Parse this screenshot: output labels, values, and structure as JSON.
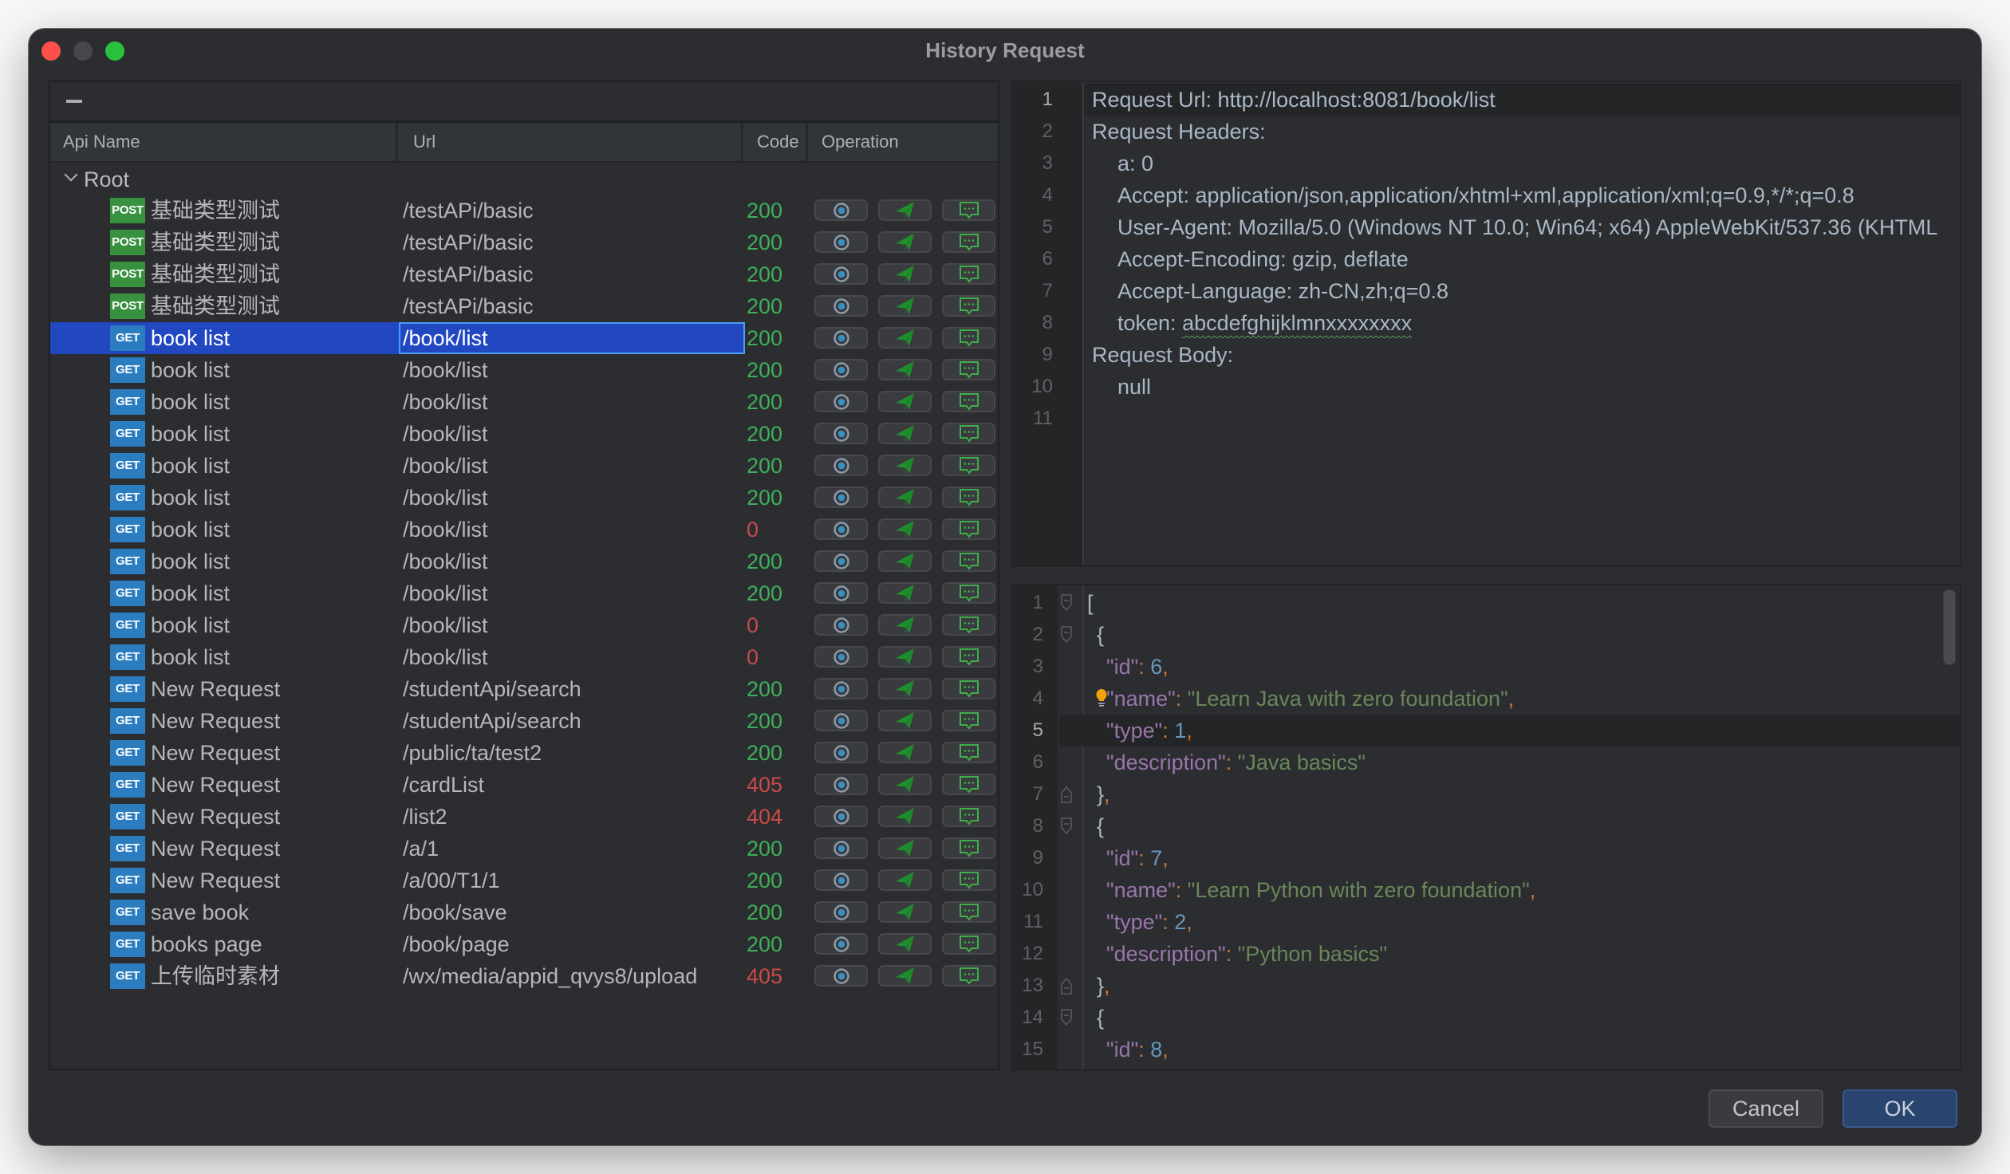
{
  "window": {
    "title": "History Request"
  },
  "table": {
    "columns": {
      "api_name": "Api Name",
      "url": "Url",
      "code": "Code",
      "operation": "Operation"
    },
    "root_label": "Root",
    "selected_index": 4,
    "rows": [
      {
        "method": "POST",
        "name": "基础类型测试",
        "url": "/testAPi/basic",
        "code": "200"
      },
      {
        "method": "POST",
        "name": "基础类型测试",
        "url": "/testAPi/basic",
        "code": "200"
      },
      {
        "method": "POST",
        "name": "基础类型测试",
        "url": "/testAPi/basic",
        "code": "200"
      },
      {
        "method": "POST",
        "name": "基础类型测试",
        "url": "/testAPi/basic",
        "code": "200"
      },
      {
        "method": "GET",
        "name": "book list",
        "url": "/book/list",
        "code": "200"
      },
      {
        "method": "GET",
        "name": "book list",
        "url": "/book/list",
        "code": "200"
      },
      {
        "method": "GET",
        "name": "book list",
        "url": "/book/list",
        "code": "200"
      },
      {
        "method": "GET",
        "name": "book list",
        "url": "/book/list",
        "code": "200"
      },
      {
        "method": "GET",
        "name": "book list",
        "url": "/book/list",
        "code": "200"
      },
      {
        "method": "GET",
        "name": "book list",
        "url": "/book/list",
        "code": "200"
      },
      {
        "method": "GET",
        "name": "book list",
        "url": "/book/list",
        "code": "0"
      },
      {
        "method": "GET",
        "name": "book list",
        "url": "/book/list",
        "code": "200"
      },
      {
        "method": "GET",
        "name": "book list",
        "url": "/book/list",
        "code": "200"
      },
      {
        "method": "GET",
        "name": "book list",
        "url": "/book/list",
        "code": "0"
      },
      {
        "method": "GET",
        "name": "book list",
        "url": "/book/list",
        "code": "0"
      },
      {
        "method": "GET",
        "name": "New Request",
        "url": "/studentApi/search",
        "code": "200"
      },
      {
        "method": "GET",
        "name": "New Request",
        "url": "/studentApi/search",
        "code": "200"
      },
      {
        "method": "GET",
        "name": "New Request",
        "url": "/public/ta/test2",
        "code": "200"
      },
      {
        "method": "GET",
        "name": "New Request",
        "url": "/cardList",
        "code": "405"
      },
      {
        "method": "GET",
        "name": "New Request",
        "url": "/list2",
        "code": "404"
      },
      {
        "method": "GET",
        "name": "New Request",
        "url": "/a/1",
        "code": "200"
      },
      {
        "method": "GET",
        "name": "New Request",
        "url": "/a/00/T1/1",
        "code": "200"
      },
      {
        "method": "GET",
        "name": "save book",
        "url": "/book/save",
        "code": "200"
      },
      {
        "method": "GET",
        "name": "books page",
        "url": "/book/page",
        "code": "200"
      },
      {
        "method": "GET",
        "name": "上传临时素材",
        "url": "/wx/media/appid_qvys8/upload",
        "code": "405"
      }
    ],
    "operations": [
      "view-icon",
      "send-icon",
      "message-icon"
    ]
  },
  "colors": {
    "code_ok": "#3fae5a",
    "code_error": "#c94a48",
    "post_badge": "#37913f",
    "get_badge": "#2b7dc0",
    "selection": "#2148c0"
  },
  "request_editor": {
    "current_line": 1,
    "lines": [
      {
        "text": "Request Url: http://localhost:8081/book/list",
        "indent": 0
      },
      {
        "text": "Request Headers:",
        "indent": 0
      },
      {
        "text": "a: 0",
        "indent": 1
      },
      {
        "text": "Accept: application/json,application/xhtml+xml,application/xml;q=0.9,*/*;q=0.8",
        "indent": 1
      },
      {
        "text": "User-Agent: Mozilla/5.0 (Windows NT 10.0; Win64; x64) AppleWebKit/537.36 (KHTML",
        "indent": 1
      },
      {
        "text": "Accept-Encoding: gzip, deflate",
        "indent": 1
      },
      {
        "text": "Accept-Language: zh-CN,zh;q=0.8",
        "indent": 1
      },
      {
        "text": "token: abcdefghijklmnxxxxxxxx",
        "indent": 1
      },
      {
        "text": "Request Body:",
        "indent": 0
      },
      {
        "text": "null",
        "indent": 1
      },
      {
        "text": "",
        "indent": 0
      }
    ]
  },
  "response_editor": {
    "current_line": 5,
    "lines": [
      {
        "tokens": [
          [
            "b",
            "["
          ]
        ],
        "indent": 0,
        "fold": "open"
      },
      {
        "tokens": [
          [
            "b",
            "{"
          ]
        ],
        "indent": 1,
        "fold": "open"
      },
      {
        "tokens": [
          [
            "k",
            "\"id\""
          ],
          [
            "p",
            ": "
          ],
          [
            "n",
            "6"
          ],
          [
            "p",
            ","
          ]
        ],
        "indent": 2
      },
      {
        "tokens": [
          [
            "k",
            "\"name\""
          ],
          [
            "p",
            ": "
          ],
          [
            "s",
            "\"Learn Java with zero foundation\""
          ],
          [
            "p",
            ","
          ]
        ],
        "indent": 2,
        "bulb": true
      },
      {
        "tokens": [
          [
            "k",
            "\"type\""
          ],
          [
            "p",
            ": "
          ],
          [
            "n",
            "1"
          ],
          [
            "p",
            ","
          ]
        ],
        "indent": 2
      },
      {
        "tokens": [
          [
            "k",
            "\"description\""
          ],
          [
            "p",
            ": "
          ],
          [
            "s",
            "\"Java basics\""
          ]
        ],
        "indent": 2
      },
      {
        "tokens": [
          [
            "b",
            "}"
          ],
          [
            "p",
            ","
          ]
        ],
        "indent": 1,
        "fold": "close"
      },
      {
        "tokens": [
          [
            "b",
            "{"
          ]
        ],
        "indent": 1,
        "fold": "open"
      },
      {
        "tokens": [
          [
            "k",
            "\"id\""
          ],
          [
            "p",
            ": "
          ],
          [
            "n",
            "7"
          ],
          [
            "p",
            ","
          ]
        ],
        "indent": 2
      },
      {
        "tokens": [
          [
            "k",
            "\"name\""
          ],
          [
            "p",
            ": "
          ],
          [
            "s",
            "\"Learn Python with zero foundation\""
          ],
          [
            "p",
            ","
          ]
        ],
        "indent": 2
      },
      {
        "tokens": [
          [
            "k",
            "\"type\""
          ],
          [
            "p",
            ": "
          ],
          [
            "n",
            "2"
          ],
          [
            "p",
            ","
          ]
        ],
        "indent": 2
      },
      {
        "tokens": [
          [
            "k",
            "\"description\""
          ],
          [
            "p",
            ": "
          ],
          [
            "s",
            "\"Python basics\""
          ]
        ],
        "indent": 2
      },
      {
        "tokens": [
          [
            "b",
            "}"
          ],
          [
            "p",
            ","
          ]
        ],
        "indent": 1,
        "fold": "close"
      },
      {
        "tokens": [
          [
            "b",
            "{"
          ]
        ],
        "indent": 1,
        "fold": "open"
      },
      {
        "tokens": [
          [
            "k",
            "\"id\""
          ],
          [
            "p",
            ": "
          ],
          [
            "n",
            "8"
          ],
          [
            "p",
            ","
          ]
        ],
        "indent": 2
      }
    ]
  },
  "buttons": {
    "cancel": "Cancel",
    "ok": "OK"
  }
}
